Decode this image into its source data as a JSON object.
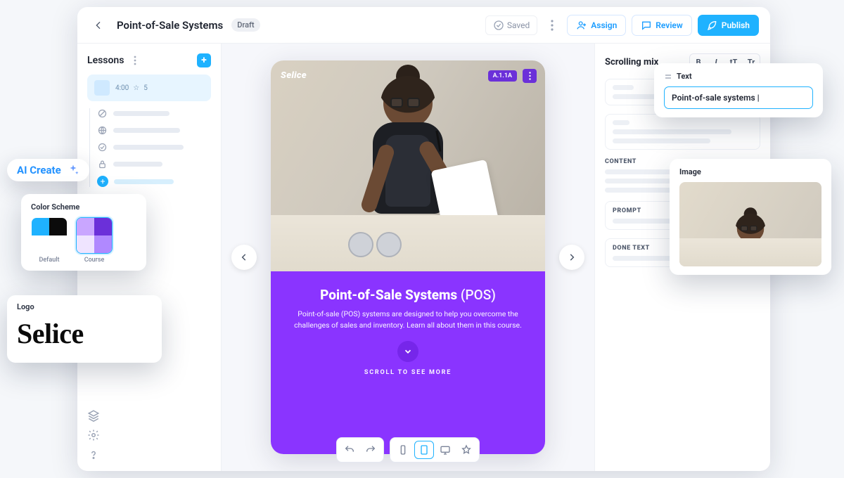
{
  "header": {
    "title": "Point-of-Sale Systems",
    "status_badge": "Draft",
    "saved_label": "Saved",
    "assign_label": "Assign",
    "review_label": "Review",
    "publish_label": "Publish"
  },
  "sidebar": {
    "heading": "Lessons",
    "active_lesson": {
      "duration": "4:00",
      "rating": "5"
    },
    "tree_icons": [
      "circle-slash-icon",
      "globe-icon",
      "check-circle-icon",
      "lock-icon",
      "add-circle-icon"
    ]
  },
  "preview": {
    "brand": "Selice",
    "hero_badge": "A.1.1A",
    "title_main": "Point-of-Sale Systems",
    "title_suffix": "(POS)",
    "description": "Point-of-sale (POS) systems are designed to help you overcome the challenges of sales and inventory. Learn all about them in this course.",
    "scroll_label": "SCROLL TO SEE MORE"
  },
  "inspector": {
    "heading": "Scrolling mix",
    "format_buttons": [
      "B",
      "I",
      "tT",
      "Tr"
    ],
    "sections": {
      "content": "CONTENT",
      "prompt": "PROMPT",
      "done": "DONE TEXT"
    }
  },
  "floats": {
    "ai_create": "AI Create",
    "color_scheme": {
      "title": "Color Scheme",
      "options": [
        {
          "label": "Default",
          "colors": [
            "#1fb2ff",
            "#0b0b0b",
            "#ffffff",
            "#ffffff"
          ]
        },
        {
          "label": "Course",
          "colors": [
            "#c9a6ff",
            "#6b30d9",
            "#efe4ff",
            "#b089ff"
          ]
        }
      ],
      "selected_index": 1
    },
    "logo": {
      "title": "Logo",
      "text": "Selice"
    },
    "text_block": {
      "title": "Text",
      "value": "Point-of-sale systems |"
    },
    "image_block": {
      "title": "Image"
    }
  }
}
